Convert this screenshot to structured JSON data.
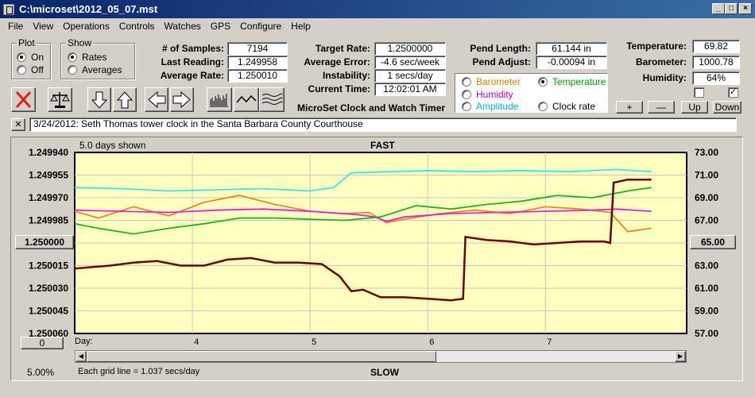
{
  "window": {
    "title": "C:\\microset\\2012_05_07.mst"
  },
  "menu": [
    "File",
    "View",
    "Operations",
    "Controls",
    "Watches",
    "GPS",
    "Configure",
    "Help"
  ],
  "plot_group": {
    "title": "Plot",
    "options": [
      "On",
      "Off"
    ],
    "selected": "On"
  },
  "show_group": {
    "title": "Show",
    "options": [
      "Rates",
      "Averages"
    ],
    "selected": "Rates"
  },
  "stats": {
    "samples_label": "# of Samples:",
    "samples": "7194",
    "last_reading_label": "Last Reading:",
    "last_reading": "1.249958",
    "average_rate_label": "Average Rate:",
    "average_rate": "1.250010",
    "target_rate_label": "Target Rate:",
    "target_rate": "1.2500000",
    "average_error_label": "Average Error:",
    "average_error": "-4.6 sec/week",
    "instability_label": "Instability:",
    "instability": "1 secs/day",
    "current_time_label": "Current Time:",
    "current_time": "12:02:01 AM",
    "pend_length_label": "Pend Length:",
    "pend_length": "61.144 in",
    "pend_adjust_label": "Pend Adjust:",
    "pend_adjust": "-0.00094 in",
    "temperature_label": "Temperature:",
    "temperature": "69.82",
    "barometer_label": "Barometer:",
    "barometer": "1000.78",
    "humidity_label": "Humidity:",
    "humidity": "64%"
  },
  "sensor_select": {
    "options": [
      {
        "label": "Barometer",
        "color": "#e08000"
      },
      {
        "label": "Temperature",
        "color": "#00a000"
      },
      {
        "label": "Humidity",
        "color": "#c000c0"
      },
      {
        "label": "Amplitude",
        "color": "#00b0e0"
      },
      {
        "label": "Clock rate",
        "color": "#000000"
      }
    ],
    "selected": "Temperature"
  },
  "app_caption": "MicroSet Clock and Watch Timer",
  "adjust_buttons": {
    "plus": "+",
    "minus": "—",
    "up": "Up",
    "down": "Down"
  },
  "toolbar_icons": [
    "delete-icon",
    "balance-scale-icon",
    "arrow-down-icon",
    "arrow-up-icon",
    "arrow-left-icon",
    "arrow-right-icon",
    "bar-graph-icon",
    "wave-icon",
    "multi-wave-icon"
  ],
  "note": {
    "close": "✕",
    "text": "3/24/2012: Seth Thomas tower clock in the Santa Barbara County Courthouse"
  },
  "plot": {
    "days_shown": "5.0 days shown",
    "top_label": "FAST",
    "bottom_label": "SLOW",
    "left_center_button": "1.250000",
    "right_center_button": "65.00",
    "zero_button": "0",
    "day_label": "Day:",
    "grid_note": "Each grid line = 1.037 secs/day",
    "percent": "5.00%"
  },
  "chart_data": {
    "type": "line",
    "x_range": [
      3.0,
      8.2
    ],
    "x_ticks": [
      "4",
      "5",
      "6",
      "7"
    ],
    "left_axis": {
      "ticks": [
        "1.249940",
        "1.249955",
        "1.249970",
        "1.249985",
        "1.250000",
        "1.250015",
        "1.250030",
        "1.250045",
        "1.250060"
      ],
      "reversed": true
    },
    "right_axis": {
      "ticks": [
        "73.00",
        "71.00",
        "69.00",
        "67.00",
        "65.00",
        "63.00",
        "61.00",
        "59.00",
        "57.00"
      ]
    },
    "ylim_right": [
      57,
      73
    ],
    "grid": true,
    "series": [
      {
        "name": "Amplitude",
        "color": "#40e0f0",
        "x": [
          3.0,
          3.4,
          3.8,
          4.2,
          4.6,
          5.0,
          5.2,
          5.35,
          5.7,
          6.0,
          6.4,
          6.8,
          7.2,
          7.6,
          7.9
        ],
        "y": [
          69.9,
          69.8,
          69.6,
          69.7,
          69.8,
          69.6,
          69.9,
          71.2,
          71.3,
          71.4,
          71.3,
          71.4,
          71.3,
          71.5,
          71.3
        ]
      },
      {
        "name": "Barometer",
        "color": "#e08a1e",
        "x": [
          3.0,
          3.2,
          3.5,
          3.8,
          4.1,
          4.4,
          4.7,
          5.0,
          5.3,
          5.5,
          5.65,
          5.8,
          6.1,
          6.4,
          6.7,
          7.0,
          7.3,
          7.55,
          7.7,
          7.9
        ],
        "y": [
          67.8,
          67.2,
          68.2,
          67.4,
          68.6,
          69.2,
          68.4,
          67.8,
          67.6,
          67.7,
          66.8,
          67.1,
          67.6,
          67.9,
          67.6,
          68.2,
          68.0,
          67.7,
          66.0,
          66.3
        ]
      },
      {
        "name": "Humidity",
        "color": "#e020e0",
        "x": [
          3.0,
          3.4,
          3.8,
          4.2,
          4.6,
          5.0,
          5.4,
          5.55,
          5.65,
          5.8,
          6.2,
          6.6,
          7.0,
          7.4,
          7.6,
          7.9
        ],
        "y": [
          67.9,
          67.8,
          67.7,
          67.9,
          68.0,
          67.8,
          67.5,
          67.3,
          66.9,
          67.3,
          67.6,
          67.7,
          67.8,
          67.9,
          68.0,
          67.8
        ]
      },
      {
        "name": "Temperature",
        "color": "#20b020",
        "x": [
          3.0,
          3.2,
          3.5,
          3.8,
          4.1,
          4.4,
          4.7,
          5.0,
          5.3,
          5.6,
          5.9,
          6.2,
          6.5,
          6.8,
          7.1,
          7.4,
          7.7,
          7.9
        ],
        "y": [
          66.7,
          66.3,
          65.8,
          66.3,
          66.7,
          67.2,
          67.2,
          67.1,
          67.0,
          67.3,
          68.3,
          68.0,
          68.4,
          68.7,
          69.2,
          69.0,
          69.6,
          69.9
        ]
      },
      {
        "name": "Clock rate",
        "color": "#6a0000",
        "x": [
          3.0,
          3.3,
          3.5,
          3.7,
          3.9,
          4.1,
          4.3,
          4.5,
          4.7,
          4.9,
          5.1,
          5.25,
          5.35,
          5.45,
          5.6,
          5.8,
          6.0,
          6.2,
          6.3,
          6.32,
          6.5,
          6.7,
          6.9,
          7.1,
          7.3,
          7.5,
          7.55,
          7.58,
          7.7,
          7.9
        ],
        "y": [
          1.250017,
          1.250015,
          1.250013,
          1.250012,
          1.250015,
          1.250015,
          1.250011,
          1.25001,
          1.250013,
          1.250013,
          1.250014,
          1.250022,
          1.250032,
          1.250031,
          1.250036,
          1.250036,
          1.250037,
          1.250038,
          1.250037,
          1.249996,
          1.249998,
          1.249999,
          1.250001,
          1.25,
          1.249999,
          1.249999,
          1.25,
          1.24996,
          1.249958,
          1.249958
        ]
      }
    ]
  }
}
